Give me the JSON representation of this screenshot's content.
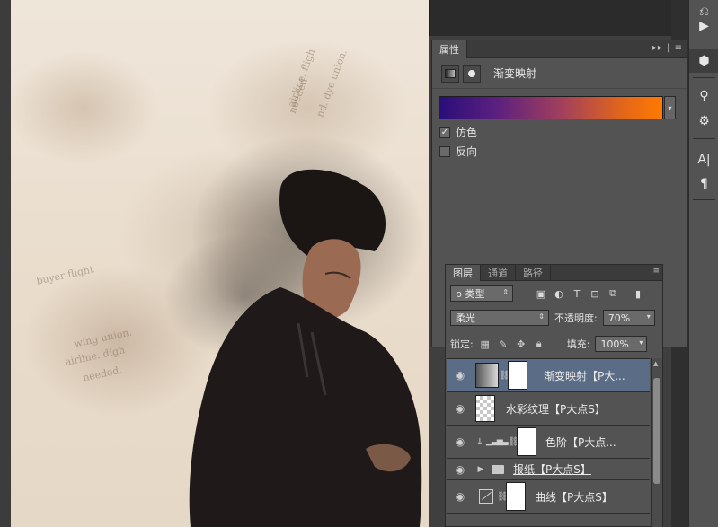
{
  "properties_panel": {
    "tab_label": "属性",
    "panel_menu": "▸▸ | ≡",
    "adjustment_title": "渐变映射",
    "gradient_dropdown": "▾",
    "dither_label": "仿色",
    "dither_checked": "✓",
    "reverse_label": "反向"
  },
  "layers_panel": {
    "tabs": [
      "图层",
      "通道",
      "路径"
    ],
    "panel_menu": "≡",
    "filter_kind": "ρ 类型",
    "blend_mode": "柔光",
    "opacity_label": "不透明度:",
    "opacity_value": "70%",
    "lock_label": "锁定:",
    "fill_label": "填充:",
    "fill_value": "100%",
    "layers": [
      {
        "name": "渐变映射【P大...",
        "selected": true
      },
      {
        "name": "水彩纹理【P大点S】",
        "selected": false
      },
      {
        "name": "色阶【P大点...",
        "selected": false
      },
      {
        "name": "报纸【P大点S】",
        "selected": false
      },
      {
        "name": "曲线【P大点S】",
        "selected": false
      }
    ]
  },
  "toolbar": {
    "text_tool": "A|",
    "paragraph_tool": "¶"
  },
  "canvas": {
    "newspaper_snippets": [
      "needed",
      "airline. fligh",
      "nd. dye union.",
      "wing union.",
      "buyer flight",
      "airline. digh",
      "needed."
    ]
  }
}
